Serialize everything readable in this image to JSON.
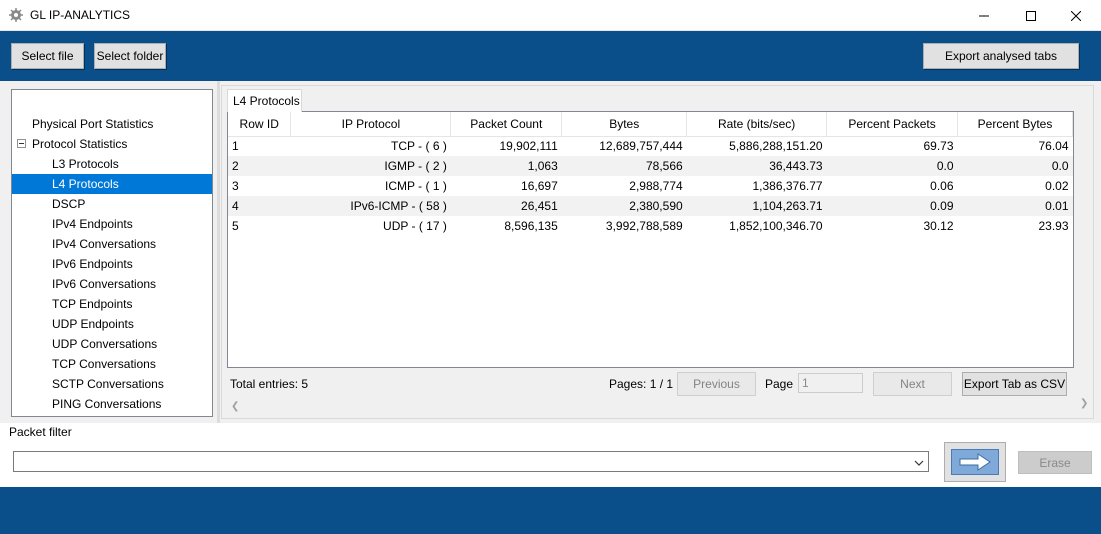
{
  "window": {
    "title": "GL IP-ANALYTICS"
  },
  "toolbar": {
    "select_file": "Select file",
    "select_folder": "Select folder",
    "export_analysed": "Export analysed tabs"
  },
  "tree": {
    "items": [
      {
        "label": "Physical Port Statistics"
      },
      {
        "label": "Protocol Statistics"
      },
      {
        "label": "L3 Protocols"
      },
      {
        "label": "L4 Protocols"
      },
      {
        "label": "DSCP"
      },
      {
        "label": "IPv4 Endpoints"
      },
      {
        "label": "IPv4 Conversations"
      },
      {
        "label": "IPv6 Endpoints"
      },
      {
        "label": "IPv6 Conversations"
      },
      {
        "label": "TCP Endpoints"
      },
      {
        "label": "UDP Endpoints"
      },
      {
        "label": "UDP Conversations"
      },
      {
        "label": "TCP Conversations"
      },
      {
        "label": "SCTP Conversations"
      },
      {
        "label": "PING Conversations"
      }
    ],
    "selected": "L4 Protocols"
  },
  "tab": {
    "label": "L4 Protocols"
  },
  "table": {
    "columns": [
      "Row ID",
      "IP Protocol",
      "Packet Count",
      "Bytes",
      "Rate (bits/sec)",
      "Percent Packets",
      "Percent Bytes"
    ],
    "rows": [
      [
        "1",
        "TCP - ( 6 )",
        "19,902,111",
        "12,689,757,444",
        "5,886,288,151.20",
        "69.73",
        "76.04"
      ],
      [
        "2",
        "IGMP - ( 2 )",
        "1,063",
        "78,566",
        "36,443.73",
        "0.0",
        "0.0"
      ],
      [
        "3",
        "ICMP - ( 1 )",
        "16,697",
        "2,988,774",
        "1,386,376.77",
        "0.06",
        "0.02"
      ],
      [
        "4",
        "IPv6-ICMP - ( 58 )",
        "26,451",
        "2,380,590",
        "1,104,263.71",
        "0.09",
        "0.01"
      ],
      [
        "5",
        "UDP - ( 17 )",
        "8,596,135",
        "3,992,788,589",
        "1,852,100,346.70",
        "30.12",
        "23.93"
      ]
    ]
  },
  "footer": {
    "total": "Total entries: 5",
    "pages": "Pages: 1 / 1",
    "previous": "Previous",
    "page_label": "Page",
    "page_value": "1",
    "next": "Next",
    "export_csv": "Export Tab as CSV"
  },
  "filter": {
    "label": "Packet filter",
    "value": "",
    "erase": "Erase"
  },
  "colors": {
    "accent_blue": "#0b4f8a",
    "selection": "#0078d7"
  }
}
